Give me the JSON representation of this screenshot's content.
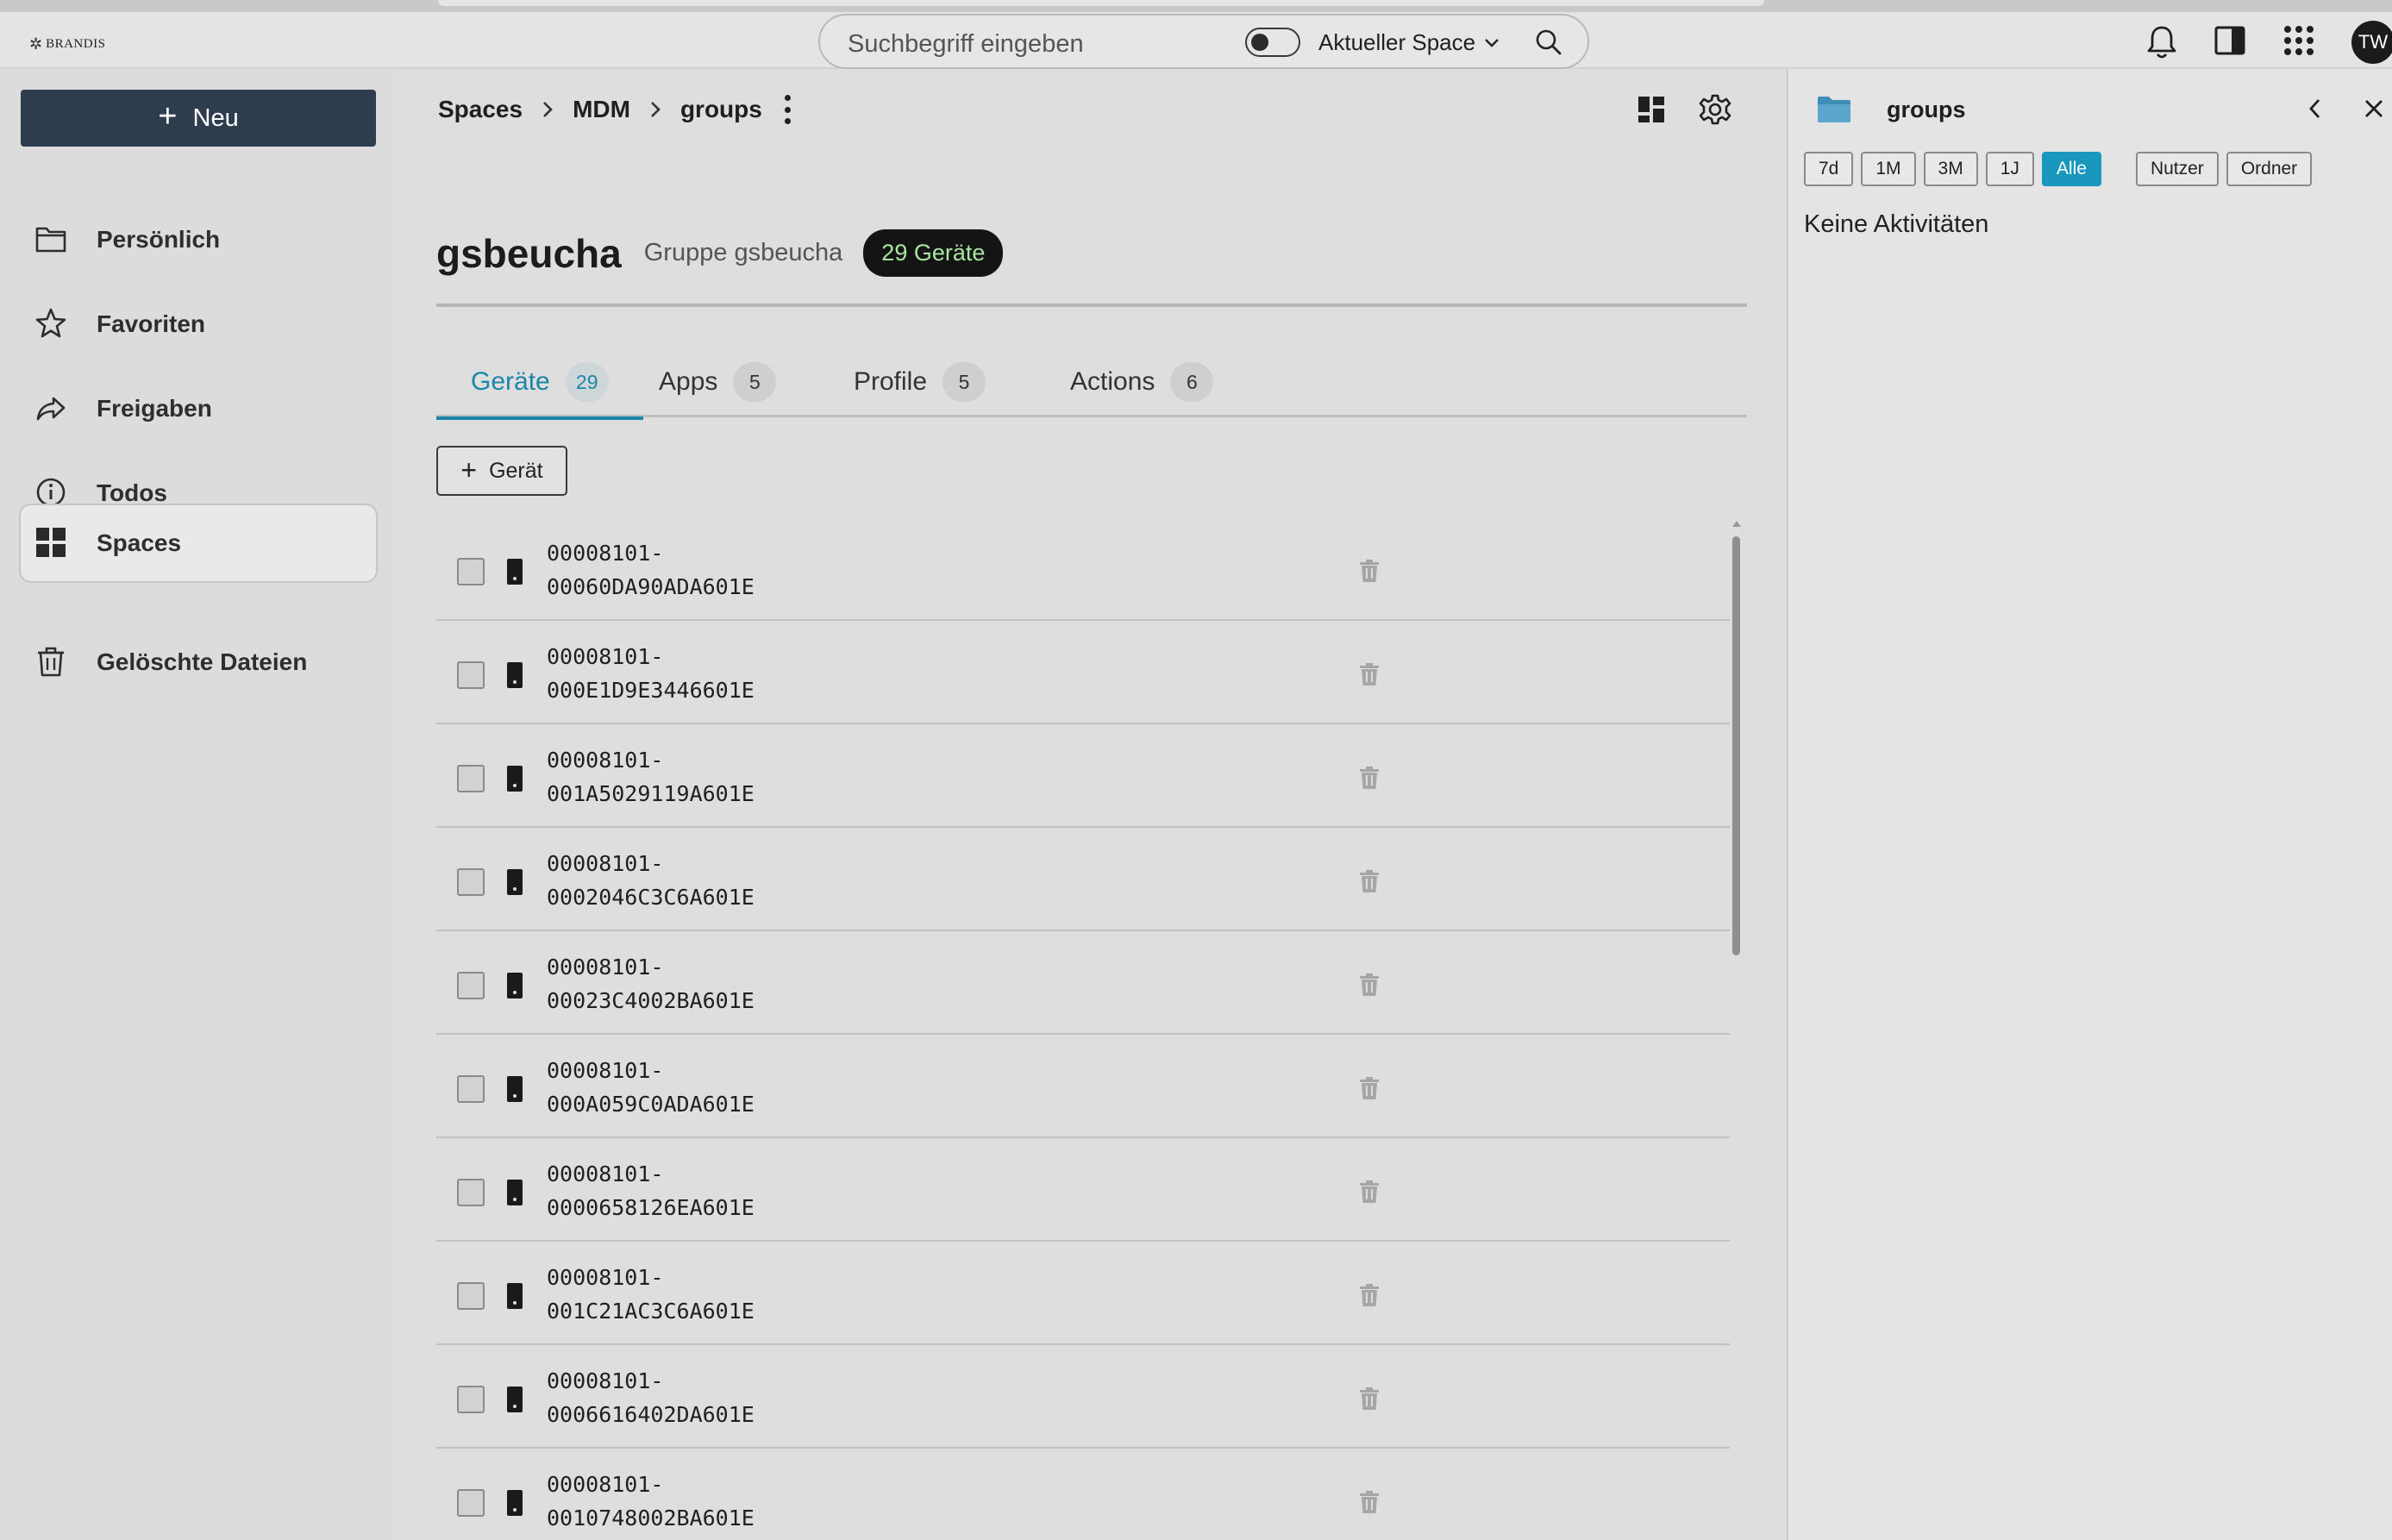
{
  "topbar": {
    "logo_text": "BRANDIS",
    "search_placeholder": "Suchbegriff eingeben",
    "scope_label": "Aktueller Space",
    "avatar_initials": "TW"
  },
  "sidebar": {
    "new_label": "Neu",
    "items": [
      {
        "label": "Persönlich",
        "icon": "folder-icon"
      },
      {
        "label": "Favoriten",
        "icon": "star-icon"
      },
      {
        "label": "Freigaben",
        "icon": "share-icon"
      },
      {
        "label": "Todos",
        "icon": "info-icon"
      },
      {
        "label": "Spaces",
        "icon": "grid-icon",
        "active": true
      },
      {
        "label": "Gelöschte Dateien",
        "icon": "trash-icon"
      }
    ]
  },
  "main": {
    "breadcrumb": [
      "Spaces",
      "MDM",
      "groups"
    ],
    "title": "gsbeucha",
    "subtitle": "Gruppe gsbeucha",
    "count_badge": "29 Geräte",
    "tabs": [
      {
        "label": "Geräte",
        "count": "29",
        "active": true
      },
      {
        "label": "Apps",
        "count": "5"
      },
      {
        "label": "Profile",
        "count": "5"
      },
      {
        "label": "Actions",
        "count": "6"
      }
    ],
    "add_device_label": "Gerät",
    "devices": [
      {
        "line1": "00008101-",
        "line2": "00060DA90ADA601E"
      },
      {
        "line1": "00008101-",
        "line2": "000E1D9E3446601E"
      },
      {
        "line1": "00008101-",
        "line2": "001A5029119A601E"
      },
      {
        "line1": "00008101-",
        "line2": "0002046C3C6A601E"
      },
      {
        "line1": "00008101-",
        "line2": "00023C4002BA601E"
      },
      {
        "line1": "00008101-",
        "line2": "000A059C0ADA601E"
      },
      {
        "line1": "00008101-",
        "line2": "0000658126EA601E"
      },
      {
        "line1": "00008101-",
        "line2": "001C21AC3C6A601E"
      },
      {
        "line1": "00008101-",
        "line2": "0006616402DA601E"
      },
      {
        "line1": "00008101-",
        "line2": "0010748002BA601E"
      }
    ]
  },
  "rightpanel": {
    "title": "groups",
    "filters": [
      "7d",
      "1M",
      "3M",
      "1J",
      "Alle"
    ],
    "active_filter": "Alle",
    "extra_filters": [
      "Nutzer",
      "Ordner"
    ],
    "empty_text": "Keine Aktivitäten"
  },
  "colors": {
    "accent": "#1c86a8",
    "filter_active": "#1a97bd",
    "primary_button": "#2d3d4e",
    "badge_bg": "#141414",
    "badge_text": "#a8e6a0"
  }
}
